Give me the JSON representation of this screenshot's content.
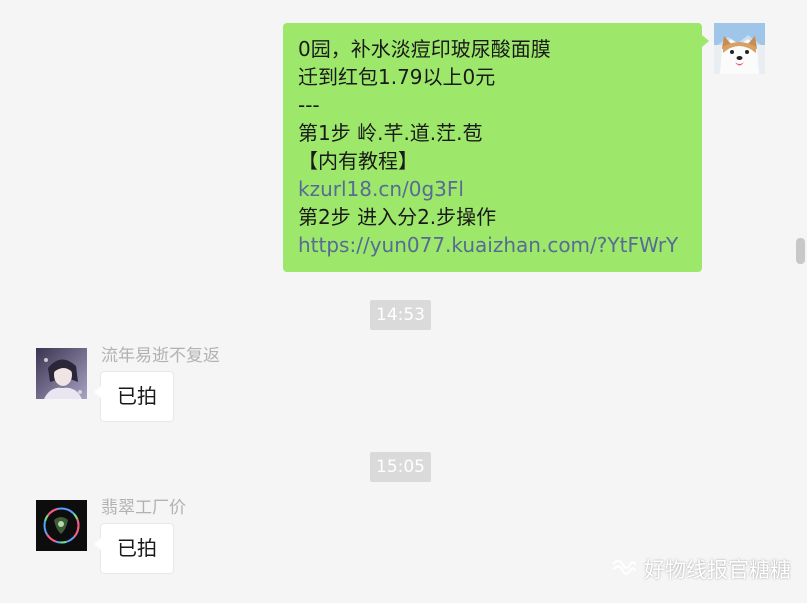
{
  "messages": {
    "outgoing": {
      "lines": [
        "0园，补水淡痘印玻尿酸面膜",
        "迁到红包1.79以上0元",
        "---",
        "第1步 岭.芊.道.茳.苞",
        "【内有教程】",
        "kzurl18.cn/0g3Fl",
        "第2步 进入分2.步操作",
        "https://yun077.kuaizhan.com/?YtFWrY"
      ]
    },
    "time1": "14:53",
    "incoming1": {
      "sender": "流年易逝不复返",
      "text": "已拍"
    },
    "time2": "15:05",
    "incoming2": {
      "sender": "翡翠工厂价",
      "text": "已拍"
    }
  },
  "watermark": {
    "text": "好物线报官糖糖",
    "icon": "wechat-channel-icon"
  },
  "colors": {
    "outgoing_bubble": "#9de86a",
    "link": "#576b95",
    "background": "#f5f5f5",
    "time_badge": "#dadada"
  }
}
